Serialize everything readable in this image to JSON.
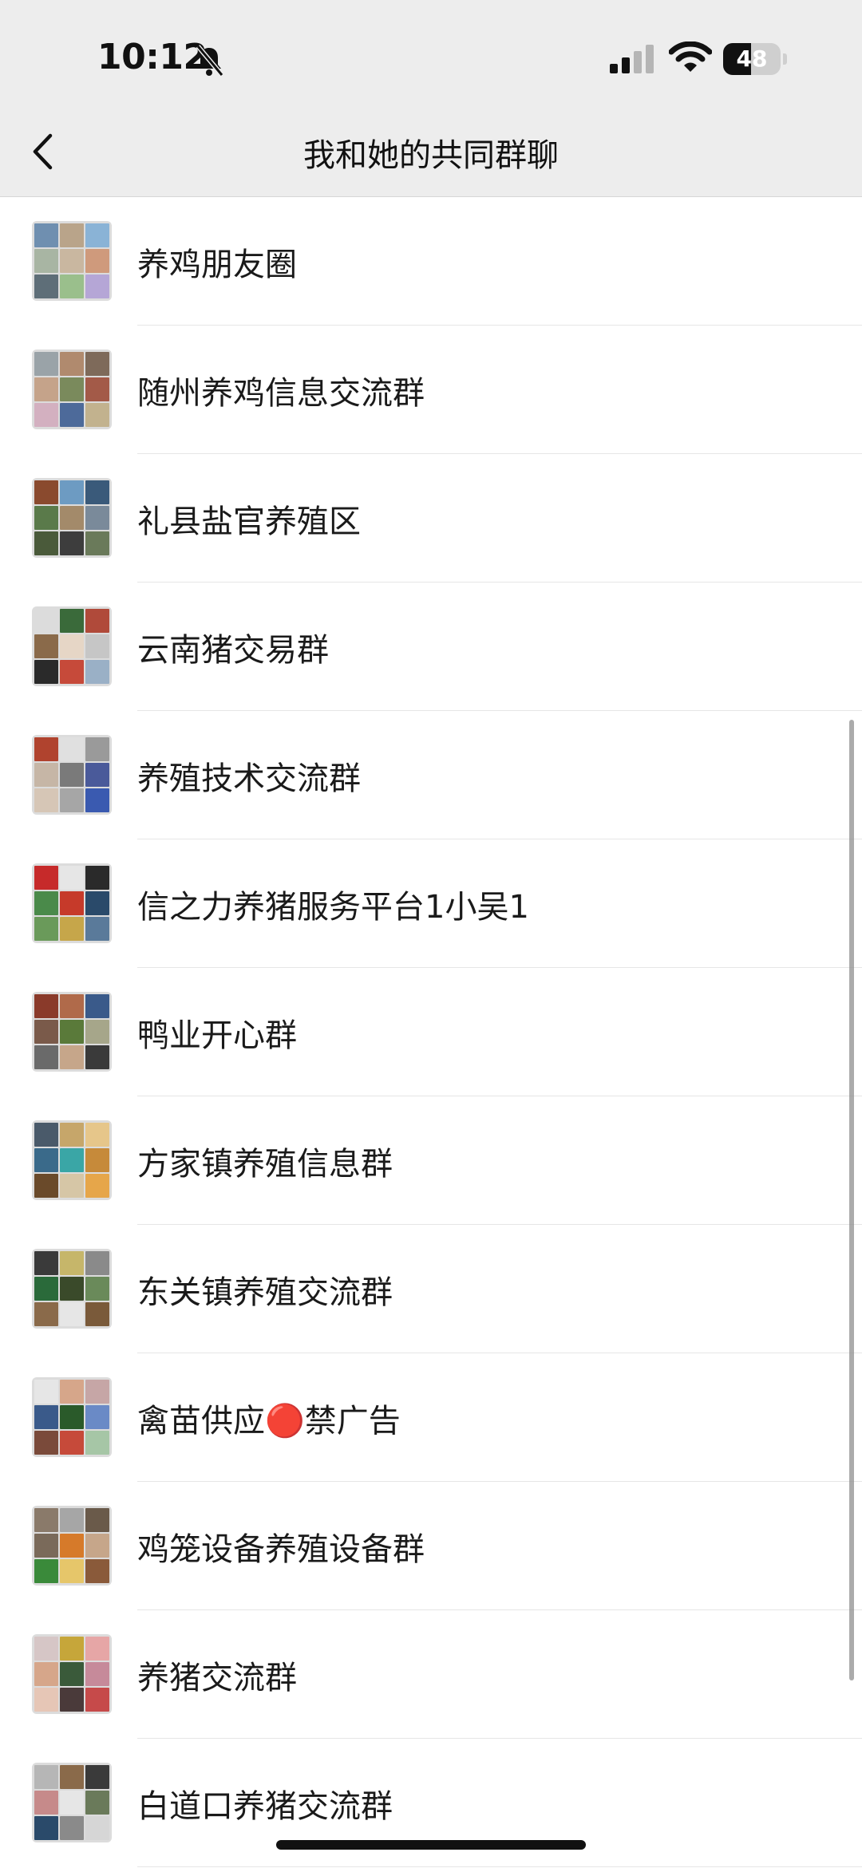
{
  "status_bar": {
    "time": "10:12",
    "battery_level": "48",
    "battery_fraction": 0.48
  },
  "nav": {
    "title": "我和她的共同群聊",
    "back_icon": "chevron-left-icon"
  },
  "groups": [
    {
      "name": "养鸡朋友圈",
      "colors": [
        "#6f8fb0",
        "#b9a48a",
        "#8ab3d6",
        "#a8b5a3",
        "#c9b7a0",
        "#cf9a7c",
        "#5e6e78",
        "#9abf8c",
        "#b5a6d6"
      ]
    },
    {
      "name": "随州养鸡信息交流群",
      "colors": [
        "#9aa3a8",
        "#b08a6e",
        "#7e6a5a",
        "#c5a38a",
        "#7a8a5c",
        "#a35a48",
        "#d3b0c0",
        "#4d6a9a",
        "#c2b28e"
      ]
    },
    {
      "name": "礼县盐官养殖区",
      "colors": [
        "#8a4a2e",
        "#6d9bc2",
        "#3a5a7a",
        "#5a7a4a",
        "#a38a6a",
        "#7a8a9a",
        "#4a5a3a",
        "#3d3d3d",
        "#6a7a5a"
      ]
    },
    {
      "name": "云南猪交易群",
      "colors": [
        "#dcdcdc",
        "#3a6a3a",
        "#b04a3a",
        "#8a6a4a",
        "#e6d6c6",
        "#c6c6c6",
        "#2a2a2a",
        "#c64a3a",
        "#9ab0c6"
      ]
    },
    {
      "name": "养殖技术交流群",
      "colors": [
        "#b0432e",
        "#e0e0e0",
        "#9a9a9a",
        "#c6b6a6",
        "#7a7a7a",
        "#4a5a9a",
        "#d6c6b6",
        "#a6a6a6",
        "#3a5ab0"
      ]
    },
    {
      "name": "信之力养猪服务平台1小吴1",
      "colors": [
        "#c62a2a",
        "#e6e6e6",
        "#2a2a2a",
        "#4a8a4a",
        "#c63a2a",
        "#2a4a6a",
        "#6a9a5a",
        "#c6a64a",
        "#5a7a9a"
      ]
    },
    {
      "name": "鸭业开心群",
      "colors": [
        "#8a3a2a",
        "#b06a4a",
        "#3a5a8a",
        "#7a5a4a",
        "#5a7a3a",
        "#a6a68a",
        "#6a6a6a",
        "#c6a68a",
        "#3a3a3a"
      ]
    },
    {
      "name": "方家镇养殖信息群",
      "colors": [
        "#4a5a6a",
        "#c6a66a",
        "#e6c68a",
        "#3a6a8a",
        "#3aa6a6",
        "#c68a3a",
        "#6a4a2a",
        "#d6c6a6",
        "#e6a64a"
      ]
    },
    {
      "name": "东关镇养殖交流群",
      "colors": [
        "#3a3a3a",
        "#c6b66a",
        "#8a8a8a",
        "#2a6a3a",
        "#3a4a2a",
        "#6a8a5a",
        "#8a6a4a",
        "#e6e6e6",
        "#7a5a3a"
      ]
    },
    {
      "name": "禽苗供应🔴禁广告",
      "colors": [
        "#e6e6e6",
        "#d6a68a",
        "#c6a6a6",
        "#3a5a8a",
        "#2a5a2a",
        "#6a8ac6",
        "#7a4a3a",
        "#c64a3a",
        "#a6c6a6"
      ]
    },
    {
      "name": "鸡笼设备养殖设备群",
      "colors": [
        "#8a7a6a",
        "#a6a6a6",
        "#6a5a4a",
        "#7a6a5a",
        "#d67a2a",
        "#c6a68a",
        "#3a8a3a",
        "#e6c66a",
        "#8a5a3a"
      ]
    },
    {
      "name": "养猪交流群",
      "colors": [
        "#d6c6c6",
        "#c6a63a",
        "#e6a6a6",
        "#d6a68a",
        "#3a5a3a",
        "#c68a9a",
        "#e6c6b6",
        "#4a3a3a",
        "#c64a4a"
      ]
    },
    {
      "name": "白道口养猪交流群",
      "colors": [
        "#b6b6b6",
        "#8a6a4a",
        "#3a3a3a",
        "#c68a8a",
        "#e6e6e6",
        "#6a7a5a",
        "#2a4a6a",
        "#8a8a8a",
        "#d6d6d6"
      ]
    }
  ]
}
